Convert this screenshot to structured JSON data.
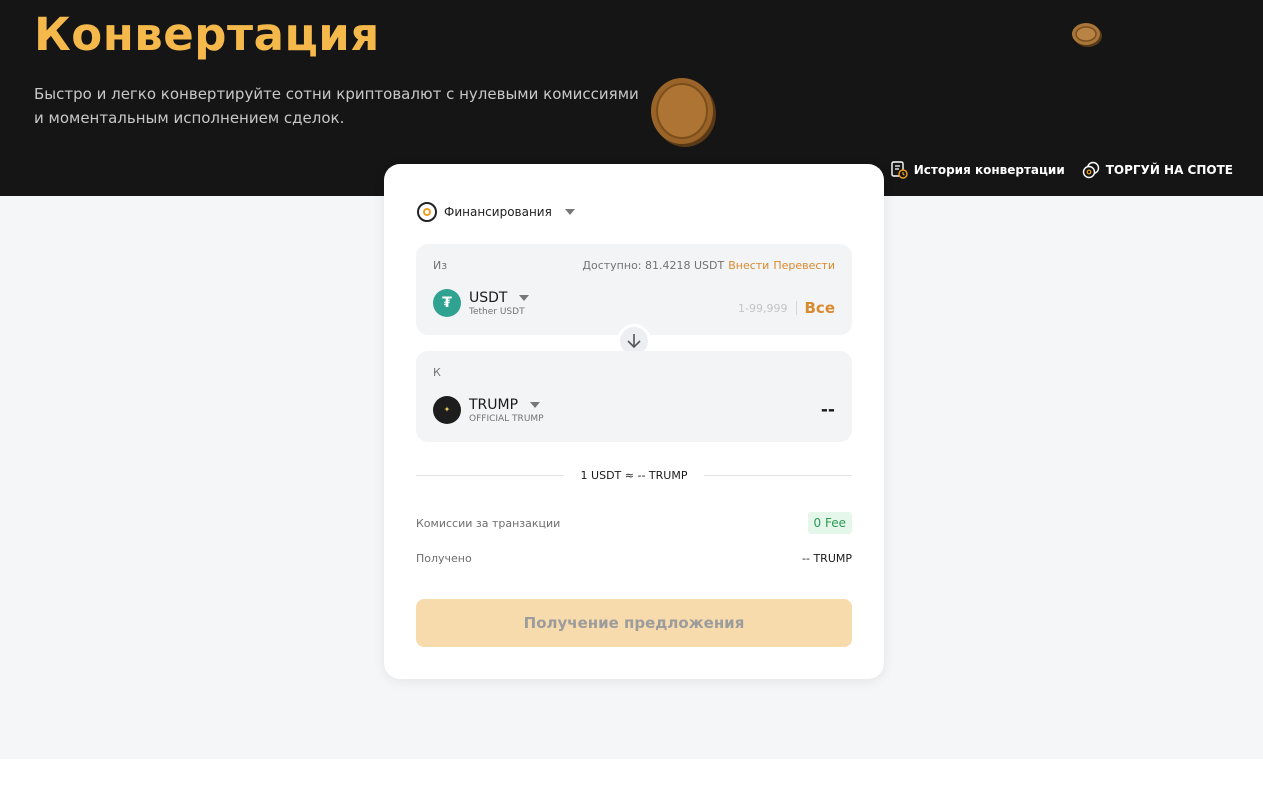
{
  "hero": {
    "title": "Конвертация",
    "subtitle": "Быстро и легко конвертируйте сотни криптовалют с нулевыми комиссиями и моментальным исполнением сделок.",
    "links": {
      "history": "История конвертации",
      "spot": "ТОРГУЙ НА СПОТЕ"
    }
  },
  "card": {
    "account": "Финансирования",
    "from": {
      "label": "Из",
      "available_prefix": "Доступно: 81.4218 USDT",
      "deposit_link": "Внести",
      "transfer_link": "Перевести",
      "symbol": "USDT",
      "name": "Tether USDT",
      "amount_placeholder": "1-99,999",
      "all_button": "Все"
    },
    "to": {
      "label": "К",
      "symbol": "TRUMP",
      "name": "OFFICIAL TRUMP",
      "amount": "--"
    },
    "rate": "1 USDT ≈ -- TRUMP",
    "fee": {
      "label": "Комиссии за транзакции",
      "value": "0 Fee"
    },
    "received": {
      "label": "Получено",
      "value": "-- TRUMP"
    },
    "quote_button": "Получение предложения"
  },
  "colors": {
    "accent": "#d98a2e",
    "title_gold": "#f4b94a",
    "fee_green": "#2d9a55",
    "usdt_green": "#2fa291"
  },
  "icons": {
    "history": "history-icon",
    "spot": "spot-coins-icon",
    "swap": "arrow-down-icon"
  }
}
